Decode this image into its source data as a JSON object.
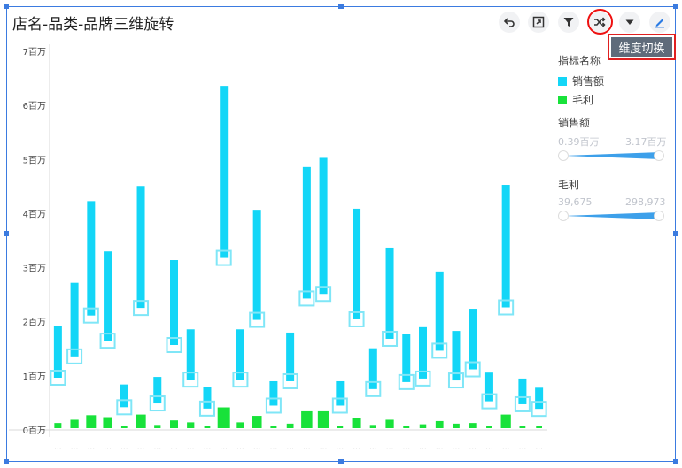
{
  "title": "店名-品类-品牌三维旋转",
  "toolbar": [
    {
      "icon": "undo-icon"
    },
    {
      "icon": "expand-icon"
    },
    {
      "icon": "filter-icon"
    },
    {
      "icon": "shuffle-icon"
    },
    {
      "icon": "caret-down-icon"
    },
    {
      "icon": "edit-icon"
    }
  ],
  "tooltip": "维度切换",
  "legend": {
    "header": "指标名称",
    "items": [
      {
        "label": "销售额",
        "color": "#13d6f7"
      },
      {
        "label": "毛利",
        "color": "#18e23a"
      }
    ]
  },
  "range_sales": {
    "title": "销售额",
    "min_label": "0.39百万",
    "max_label": "3.17百万"
  },
  "range_profit": {
    "title": "毛利",
    "min_label": "39,675",
    "max_label": "298,973"
  },
  "chart_data": {
    "type": "bar",
    "y_ticks": [
      "0百万",
      "1百万",
      "2百万",
      "3百万",
      "4百万",
      "5百万",
      "6百万",
      "7百万"
    ],
    "ylim": [
      0,
      7000000
    ],
    "x_tick_label": "...",
    "categories_count": 29,
    "series": [
      {
        "name": "销售额",
        "values": [
          1.93,
          2.72,
          4.23,
          3.3,
          0.84,
          4.51,
          0.98,
          3.14,
          1.86,
          0.79,
          6.36,
          1.86,
          4.07,
          0.9,
          1.8,
          4.86,
          5.03,
          0.9,
          4.09,
          1.51,
          3.37,
          1.77,
          1.9,
          2.93,
          1.83,
          2.24,
          1.06,
          4.53,
          0.95,
          0.78
        ]
      },
      {
        "name": "毛利",
        "values": [
          0.08,
          0.13,
          0.2,
          0.17,
          0.03,
          0.21,
          0.05,
          0.12,
          0.09,
          0.03,
          0.32,
          0.09,
          0.19,
          0.04,
          0.07,
          0.26,
          0.26,
          0.03,
          0.16,
          0.05,
          0.13,
          0.04,
          0.06,
          0.11,
          0.07,
          0.08,
          0.03,
          0.21,
          0.03,
          0.03
        ]
      }
    ]
  }
}
